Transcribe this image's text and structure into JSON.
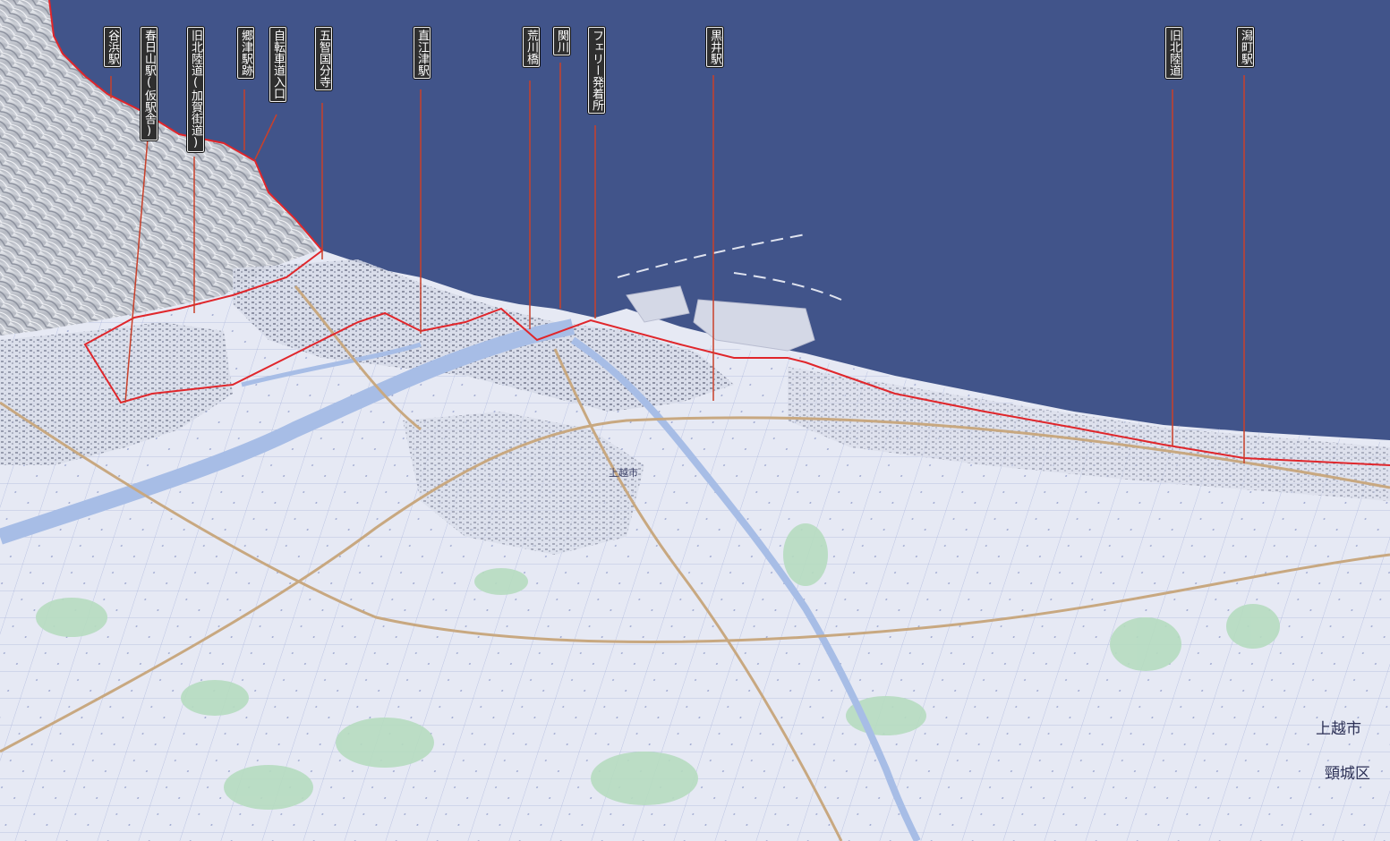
{
  "map": {
    "colors": {
      "sea": "#41548a",
      "land": "#e6e9f4",
      "route": "#e0262b",
      "leader": "#c9402a",
      "river": "#a7bde6",
      "rail": "#c8a880",
      "green": "#b6dcc0"
    },
    "labels": [
      {
        "id": "tanihama-eki",
        "text": "谷浜駅"
      },
      {
        "id": "kasugayama-eki",
        "text": "春日山駅(仮駅舎)"
      },
      {
        "id": "kyu-hokurikudo-kaga",
        "text": "旧北陸道(加賀街道)"
      },
      {
        "id": "gouzu-ekiato",
        "text": "郷津駅跡"
      },
      {
        "id": "jitensha-doiriguchi",
        "text": "自転車道入口"
      },
      {
        "id": "gochi-kokubunji",
        "text": "五智国分寺"
      },
      {
        "id": "naoetsu-eki",
        "text": "直江津駅"
      },
      {
        "id": "arakawa-bashi",
        "text": "荒川橋"
      },
      {
        "id": "sekigawa",
        "text": "関川"
      },
      {
        "id": "ferry-hacchakujo",
        "text": "フェリー発着所"
      },
      {
        "id": "kuroi-eki",
        "text": "黒井駅"
      },
      {
        "id": "kyu-hokurikudo",
        "text": "旧北陸道"
      },
      {
        "id": "katagata-eki",
        "text": "潟町駅"
      }
    ],
    "place_names": [
      {
        "id": "jouetsu-city",
        "text": "上越市"
      },
      {
        "id": "kubiki-ku",
        "text": "頸城区"
      },
      {
        "id": "takadashin",
        "text": "上越市"
      }
    ]
  }
}
